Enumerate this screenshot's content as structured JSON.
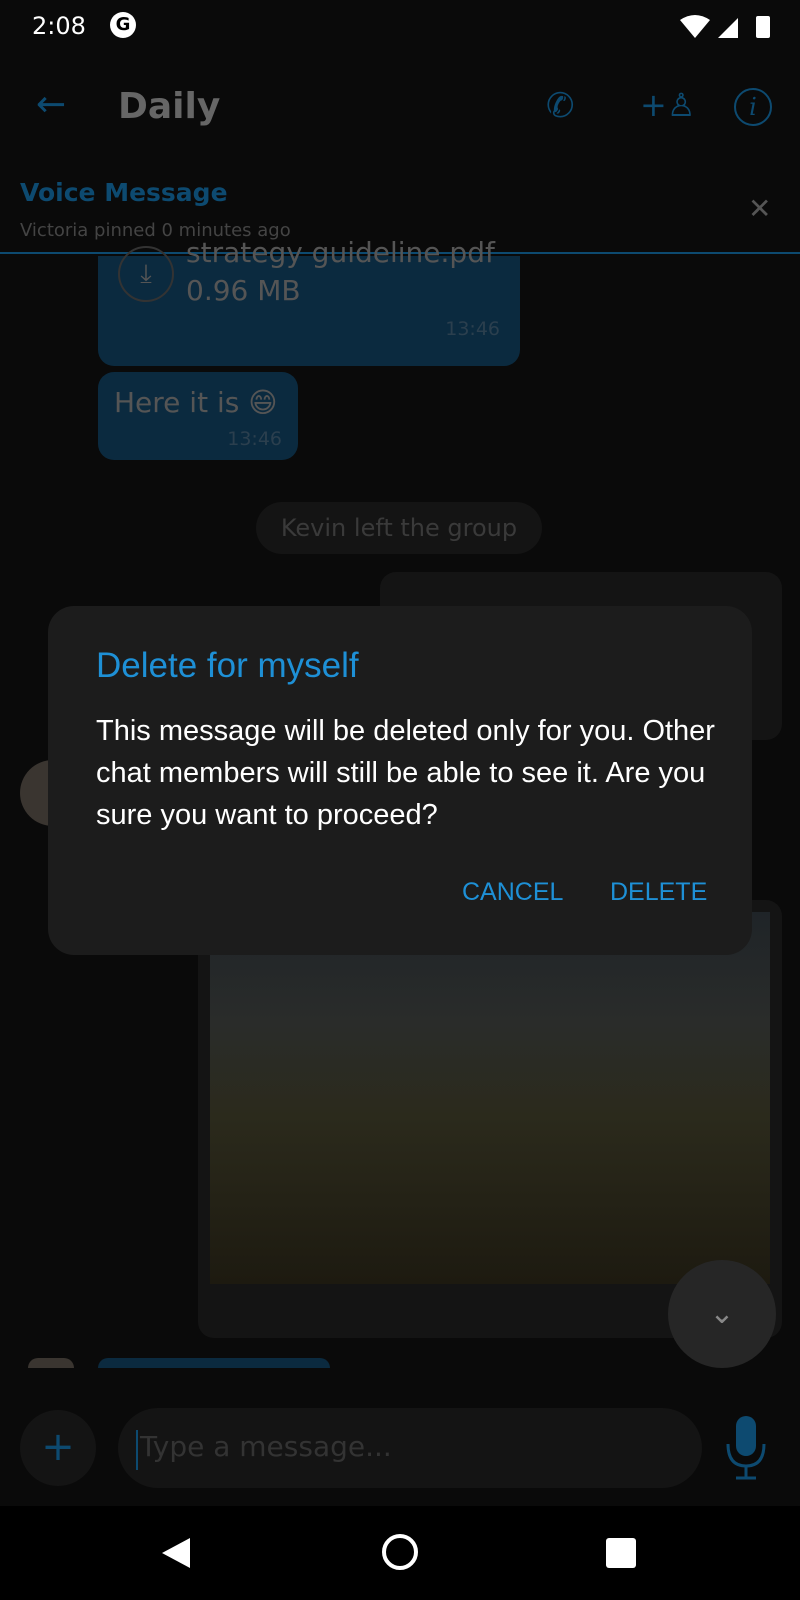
{
  "status_bar": {
    "time": "2:08",
    "app_icon": "google-g-icon",
    "icons": [
      "wifi-icon",
      "signal-icon",
      "battery-icon"
    ]
  },
  "app_bar": {
    "title": "Daily",
    "icons": [
      "back-arrow-icon",
      "phone-icon",
      "add-person-icon",
      "info-icon"
    ]
  },
  "pinned": {
    "title": "Voice Message",
    "subtitle": "Victoria pinned 0 minutes ago"
  },
  "messages": {
    "file": {
      "name": "strategy guideline.pdf",
      "size": "0.96 MB",
      "time": "13:46"
    },
    "text": {
      "body": "Here it is 😄",
      "time": "13:46"
    },
    "system": "Kevin left the group"
  },
  "composer": {
    "placeholder": "Type a message..."
  },
  "dialog": {
    "title": "Delete for myself",
    "body": "This message will be deleted only for you. Other chat members will still be able to see it. Are you sure you want to proceed?",
    "cancel": "CANCEL",
    "delete": "DELETE"
  },
  "colors": {
    "accent": "#1e90d6",
    "dialog_bg": "#1c1c1c"
  }
}
